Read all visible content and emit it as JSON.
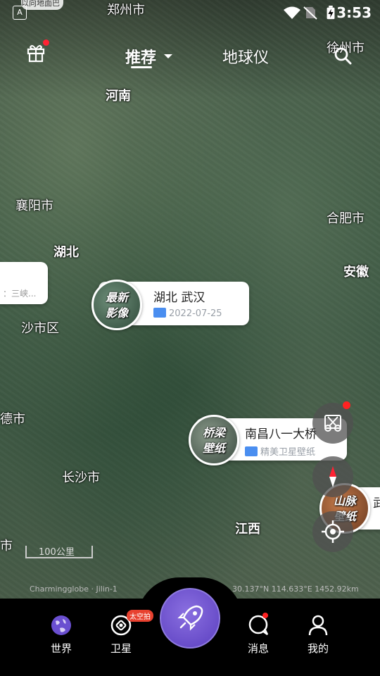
{
  "status_bar": {
    "time": "3:53",
    "notification_preview": "以向地面巴盆",
    "app_icon_letter": "A"
  },
  "top_nav": {
    "tabs": [
      {
        "label": "推荐",
        "active": true
      },
      {
        "label": "地球仪",
        "active": false
      }
    ]
  },
  "map": {
    "places": [
      {
        "name": "郑州市"
      },
      {
        "name": "徐州市"
      },
      {
        "name": "河南"
      },
      {
        "name": "襄阳市"
      },
      {
        "name": "合肥市"
      },
      {
        "name": "湖北"
      },
      {
        "name": "安徽"
      },
      {
        "name": "沙市区"
      },
      {
        "name": "德市"
      },
      {
        "name": "长沙市"
      },
      {
        "name": "江西"
      },
      {
        "name": "市"
      }
    ],
    "partial_callout_text": "：三峡..."
  },
  "callouts": [
    {
      "badge_line1": "最新",
      "badge_line2": "影像",
      "title": "湖北 武汉",
      "subtitle": "2022-07-25"
    },
    {
      "badge_line1": "桥梁",
      "badge_line2": "壁纸",
      "title": "南昌八一大桥",
      "subtitle": "精美卫星壁纸"
    },
    {
      "badge_line1": "山脉",
      "badge_line2": "壁纸",
      "title": "武",
      "subtitle": ""
    }
  ],
  "scale_bar": {
    "label": "100公里"
  },
  "attribution": {
    "source": "Charmingglobe · Jilin-1",
    "coordinates": "30.137°N 114.633°E 1452.92km"
  },
  "bottom_nav": {
    "items": [
      {
        "label": "世界"
      },
      {
        "label": "卫星",
        "badge": "太空拍"
      },
      {
        "label": "消息"
      },
      {
        "label": "我的"
      }
    ]
  },
  "colors": {
    "accent_purple": "#6a4fd0",
    "notification_red": "#e8412f",
    "date_icon_blue": "#4a8ef0"
  }
}
